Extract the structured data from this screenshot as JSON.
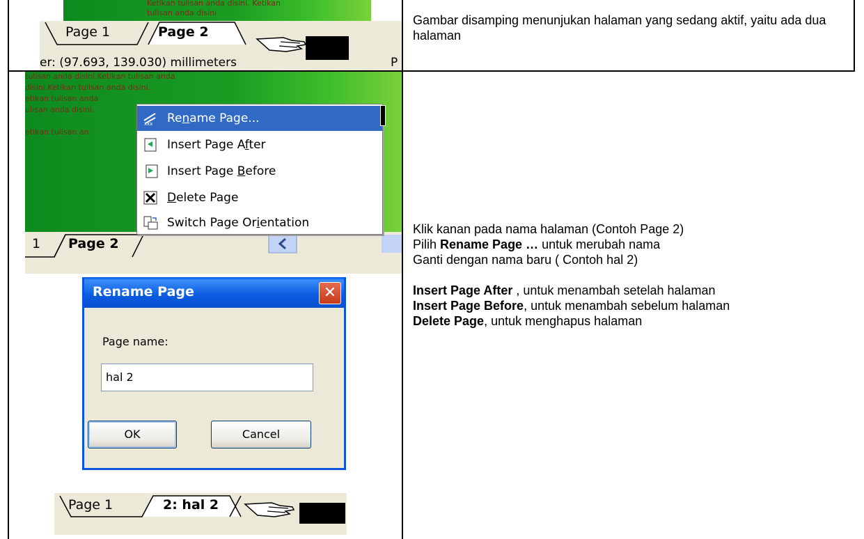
{
  "row1": {
    "tabs": [
      "Page 1",
      "Page 2"
    ],
    "status": "er: (97.693, 139.030) millimeters",
    "status_right": "P",
    "green_text": [
      "Ketikan tulisan anda disini. Ketikan",
      "tulisan anda disini"
    ],
    "description": "Gambar disamping menunjukan halaman yang sedang aktif, yaitu ada dua halaman"
  },
  "row2": {
    "green_lines": [
      "tulisan anda disini.Ketikan tulisan anda",
      "disini.Ketikan tulisan anda disini.",
      "etikan tulisan anda",
      "ulisan anda disini.",
      "",
      "etikan tulisan an"
    ],
    "menu": {
      "items": [
        {
          "pre": "Re",
          "u": "n",
          "post": "ame Page...",
          "icon": "rename-page-icon"
        },
        {
          "pre": "Insert Page A",
          "u": "f",
          "post": "ter",
          "icon": "insert-page-after-icon"
        },
        {
          "pre": "Insert Page ",
          "u": "B",
          "post": "efore",
          "icon": "insert-page-before-icon"
        },
        {
          "pre": "",
          "u": "D",
          "post": "elete Page",
          "icon": "delete-page-icon"
        },
        {
          "pre": "Switch Page Or",
          "u": "i",
          "post": "entation",
          "icon": "switch-orientation-icon"
        }
      ]
    },
    "tab_left": "1",
    "tab_active": "Page 2",
    "dialog": {
      "title": "Rename Page",
      "label": "Page name:",
      "value": "hal 2",
      "ok": "OK",
      "cancel": "Cancel"
    },
    "tabs_after": [
      "Page 1",
      "2: hal 2"
    ],
    "instructions": {
      "line1": "Klik kanan pada nama halaman (Contoh Page 2)",
      "line2_pre": "Pilih ",
      "line2_bold": "Rename Page …",
      "line2_post": " untuk merubah nama",
      "line3": "Ganti dengan nama baru ( Contoh hal 2)",
      "line4_bold": "Insert Page After",
      "line4_post": " , untuk menambah setelah halaman",
      "line5_bold": "Insert Page Before",
      "line5_post": ", untuk menambah sebelum halaman",
      "line6_bold": "Delete Page",
      "line6_post": ", untuk menghapus halaman"
    }
  }
}
